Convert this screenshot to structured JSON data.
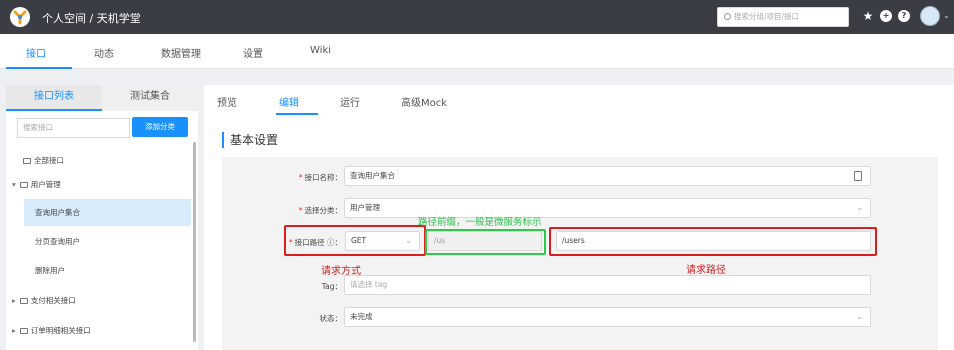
{
  "header": {
    "breadcrumb": "个人空间 / 天机学堂",
    "search_placeholder": "搜索分组/项目/接口",
    "icons": [
      "star-icon",
      "add-icon",
      "help-icon"
    ]
  },
  "nav_tabs": [
    {
      "label": "接口",
      "active": true
    },
    {
      "label": "动态",
      "active": false
    },
    {
      "label": "数据管理",
      "active": false
    },
    {
      "label": "设置",
      "active": false
    },
    {
      "label": "Wiki",
      "active": false
    }
  ],
  "left": {
    "tabs": [
      {
        "label": "接口列表",
        "active": true
      },
      {
        "label": "测试集合",
        "active": false
      }
    ],
    "search_placeholder": "搜索接口",
    "add_button": "添加分类",
    "tree": [
      {
        "label": "全部接口",
        "level": 0
      },
      {
        "label": "用户管理",
        "level": 0,
        "expanded": true
      },
      {
        "label": "查询用户集合",
        "level": 1,
        "selected": true
      },
      {
        "label": "分页查询用户",
        "level": 1
      },
      {
        "label": "删除用户",
        "level": 1
      },
      {
        "label": "支付相关接口",
        "level": 0
      },
      {
        "label": "订单明细相关接口",
        "level": 0
      }
    ]
  },
  "subtabs": [
    {
      "label": "预览",
      "active": false
    },
    {
      "label": "编辑",
      "active": true
    },
    {
      "label": "运行",
      "active": false
    },
    {
      "label": "高级Mock",
      "active": false
    }
  ],
  "section_title": "基本设置",
  "form": {
    "name_label": "接口名称：",
    "name_value": "查询用户集合",
    "category_label": "选择分类：",
    "category_value": "用户管理",
    "path_label": "接口路径 ⓘ：",
    "method_value": "GET",
    "path_prefix": "/us",
    "path_value": "/users",
    "tag_label": "Tag：",
    "tag_placeholder": "请选择 tag",
    "status_label": "状态：",
    "status_value": "未完成"
  },
  "annotations": {
    "method": "请求方式",
    "prefix": "路径前缀，一般是微服务标示",
    "path": "请求路径"
  },
  "colors": {
    "accent": "#1890ff",
    "header_bg": "#3a3d44",
    "annotation_red": "#d81e1e",
    "annotation_green": "#2cc94a"
  }
}
